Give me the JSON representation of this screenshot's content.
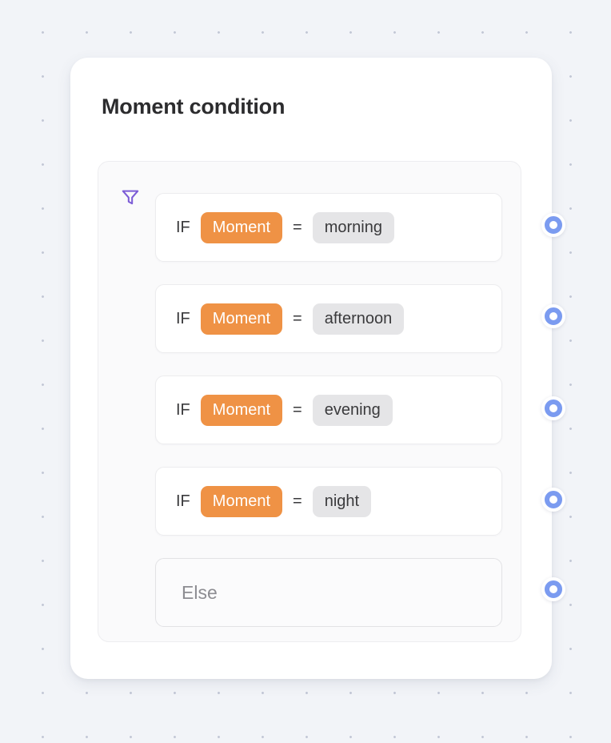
{
  "canvas": {
    "background_color": "#f2f4f8",
    "dot_color": "#c3c8d6",
    "dot_spacing_px": 55
  },
  "node": {
    "title": "Moment condition",
    "accent_field_color": "#ef9245",
    "value_chip_color": "#e5e5e7",
    "port_color": "#7b9bf0",
    "filter_icon_color": "#7c5cd6",
    "filter_icon": "funnel-icon",
    "conditions": [
      {
        "prefix": "IF",
        "field": "Moment",
        "operator": "=",
        "value": "morning"
      },
      {
        "prefix": "IF",
        "field": "Moment",
        "operator": "=",
        "value": "afternoon"
      },
      {
        "prefix": "IF",
        "field": "Moment",
        "operator": "=",
        "value": "evening"
      },
      {
        "prefix": "IF",
        "field": "Moment",
        "operator": "=",
        "value": "night"
      }
    ],
    "fallback": {
      "label": "Else"
    },
    "ports": [
      {
        "label": "output-port-morning"
      },
      {
        "label": "output-port-afternoon"
      },
      {
        "label": "output-port-evening"
      },
      {
        "label": "output-port-night"
      },
      {
        "label": "output-port-else"
      }
    ]
  }
}
